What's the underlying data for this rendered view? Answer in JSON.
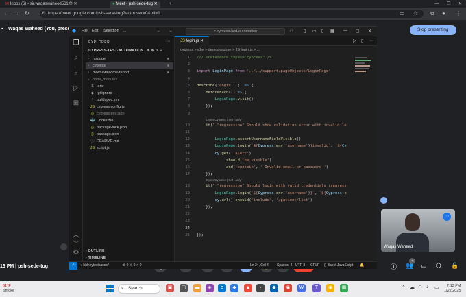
{
  "browser": {
    "tabs": [
      {
        "label": "Inbox (6) - sir.waqaswaheed561@"
      },
      {
        "label": "Meet - psh-sede-tug"
      }
    ],
    "url": "https://meet.google.com/psh-sede-tug?authuser=0&pli=1"
  },
  "meet": {
    "presenter_label": "Waqas Waheed (You, presenting)",
    "stop_label": "Stop presenting",
    "meeting_info": "13 PM  |  psh-sede-tug",
    "self_name": "Waqas Waheed",
    "people_count": "2"
  },
  "vscode": {
    "menu": [
      "File",
      "Edit",
      "Selection"
    ],
    "search": "cypress-test-automation",
    "explorer_label": "EXPLORER",
    "root": "CYPRESS-TEST-AUTOMATION",
    "tree": [
      {
        "label": ".vscode",
        "icon": "›",
        "color": "#cccccc"
      },
      {
        "label": "cypress",
        "icon": "›",
        "color": "#cccccc"
      },
      {
        "label": "mochawesome-report",
        "icon": "›",
        "color": "#cccccc"
      },
      {
        "label": "node_modules",
        "icon": "›",
        "color": "#8b8b8b"
      },
      {
        "label": ".env",
        "icon": "$",
        "color": "#cccccc"
      },
      {
        "label": ".gitignore",
        "icon": "◆",
        "color": "#cccccc"
      },
      {
        "label": "buildspec.yml",
        "icon": "!",
        "color": "#cccccc"
      },
      {
        "label": "cypress.config.js",
        "icon": "JS",
        "color": "#cccccc"
      },
      {
        "label": "cypress.env.json",
        "icon": "{}",
        "color": "#8b8b8b"
      },
      {
        "label": "Dockerfile",
        "icon": "🐳",
        "color": "#cccccc"
      },
      {
        "label": "package-lock.json",
        "icon": "{}",
        "color": "#cccccc"
      },
      {
        "label": "package.json",
        "icon": "{}",
        "color": "#cccccc"
      },
      {
        "label": "README.md",
        "icon": "ⓘ",
        "color": "#cccccc"
      },
      {
        "label": "script.js",
        "icon": "JS",
        "color": "#cccccc"
      }
    ],
    "outline_label": "OUTLINE",
    "timeline_label": "TIMELINE",
    "file_tab": "login.js",
    "breadcrumb": "cypress  >  e2e  >  demopurpose  >  JS login.js  >  ...",
    "lens_1": "Open Cypress | Set '.only'",
    "lens_2": "Open Cypress | Set '.only'",
    "code": [
      {
        "n": "1",
        "html": "<span class='c'>/// &lt;reference types=\"cypress\" /&gt;</span>"
      },
      {
        "n": "2",
        "html": ""
      },
      {
        "n": "3",
        "html": "<span class='k'>import</span> <span class='v'>LoginPage</span> <span class='k'>from</span> <span class='s'>'../../support/pageObjects/LoginPage'</span>"
      },
      {
        "n": "4",
        "html": ""
      },
      {
        "n": "5",
        "html": "<span class='f'>describe</span>(<span class='s'>'Login'</span>, () <span class='kw'>=&gt;</span> {"
      },
      {
        "n": "6",
        "html": "    <span class='f'>beforeEach</span>(() <span class='kw'>=&gt;</span> {"
      },
      {
        "n": "7",
        "html": "        <span class='cls'>LoginPage</span>.<span class='f'>visit</span>()"
      },
      {
        "n": "8",
        "html": "    });"
      },
      {
        "n": "9",
        "html": ""
      },
      {
        "n": "10",
        "html": "    <span class='f'>it</span>(<span class='s'>\" \"regression\" Should show validation error with invalid lo</span>"
      },
      {
        "n": "11",
        "html": ""
      },
      {
        "n": "12",
        "html": "        <span class='cls'>LoginPage</span>.<span class='f'>assertUsernameFieldVisible</span>()"
      },
      {
        "n": "13",
        "html": "        <span class='cls'>LoginPage</span>.<span class='f'>login</span>(<span class='s'>`${</span><span class='v'>Cypress</span>.<span class='f'>env</span>(<span class='s'>'username'</span>)<span class='s'>}invalid`</span>, <span class='s'>`${</span><span class='v'>Cy</span>"
      },
      {
        "n": "14",
        "html": "        <span class='v'>cy</span>.<span class='f'>get</span>(<span class='s'>'.alert'</span>)"
      },
      {
        "n": "15",
        "html": "            .<span class='f'>should</span>(<span class='s'>'be.visible'</span>)"
      },
      {
        "n": "16",
        "html": "            .<span class='f'>and</span>(<span class='s'>'contain'</span>, <span class='s'>' Invalid email or password '</span>)"
      },
      {
        "n": "17",
        "html": "    });"
      },
      {
        "n": "18",
        "html": "    <span class='f'>it</span>(<span class='s'>\" \"regression\" Should login with valid credentials (regress</span>"
      },
      {
        "n": "19",
        "html": "        <span class='cls'>LoginPage</span>.<span class='f'>login</span>(<span class='s'>`${</span><span class='v'>Cypress</span>.<span class='f'>env</span>(<span class='s'>'username'</span>)<span class='s'>}`</span>, <span class='s'>`${</span><span class='v'>Cypress</span>.<span class='f'>e</span>"
      },
      {
        "n": "20",
        "html": "        <span class='v'>cy</span>.<span class='f'>url</span>().<span class='f'>should</span>(<span class='s'>'include'</span>, <span class='s'>'/patient/list'</span>)"
      },
      {
        "n": "21",
        "html": "    });"
      },
      {
        "n": "22",
        "html": ""
      },
      {
        "n": "23",
        "html": ""
      },
      {
        "n": "24",
        "html": ""
      },
      {
        "n": "25",
        "html": "});"
      }
    ],
    "status": {
      "branch": "kidneytestcases*",
      "errors": "⊗ 0 ⚠ 0  ⚡ 0",
      "position": "Ln 24, Col 4",
      "spaces": "Spaces: 4",
      "encoding": "UTF-8",
      "eol": "CRLF",
      "lang": "{} Babel JavaScript"
    }
  },
  "taskbar": {
    "weather_temp": "61°F",
    "weather_desc": "Smoke",
    "search_placeholder": "Search",
    "time": "7:13 PM",
    "date": "1/22/2025"
  }
}
